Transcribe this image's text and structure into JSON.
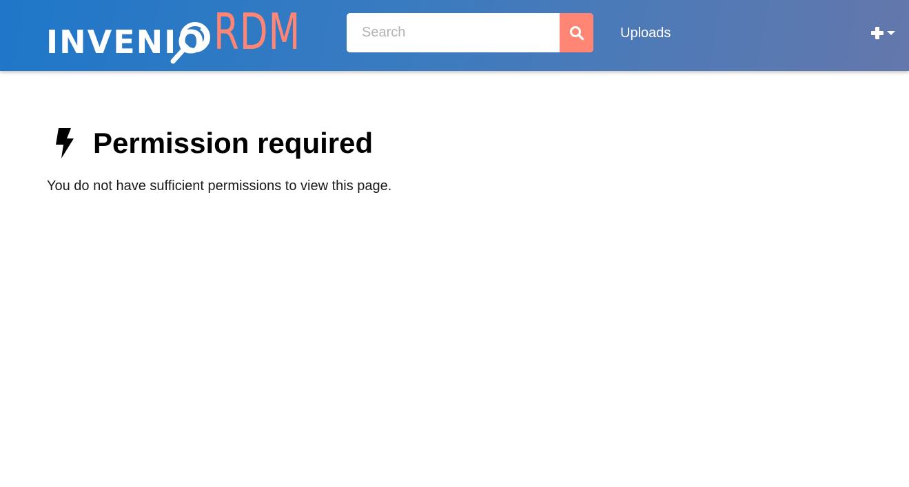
{
  "header": {
    "logo": {
      "primary_text": "INVENIO",
      "accent_text": "RDM",
      "accent_color": "#ff8574"
    },
    "search": {
      "placeholder": "Search",
      "button_icon": "search-icon"
    },
    "nav": {
      "uploads_label": "Uploads"
    },
    "new_menu": {
      "icons": [
        "plus-icon",
        "caret-down-icon"
      ]
    },
    "colors": {
      "gradient_start": "#1f77c9",
      "gradient_end": "#6478ac"
    }
  },
  "main": {
    "icon": "lightning-bolt-icon",
    "title": "Permission required",
    "message": "You do not have sufficient permissions to view this page."
  }
}
